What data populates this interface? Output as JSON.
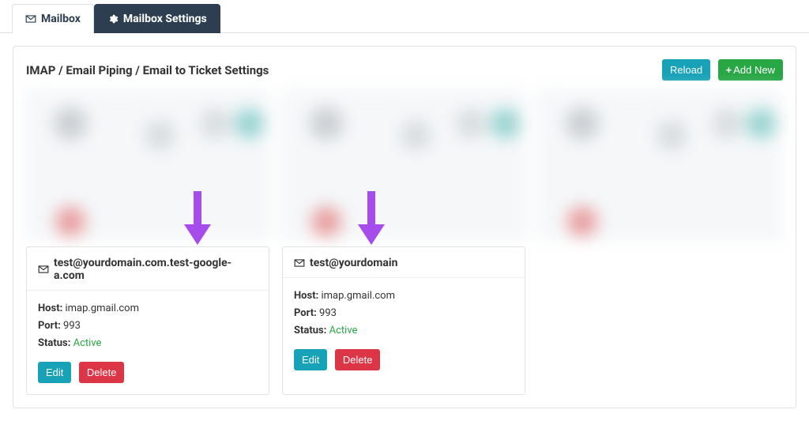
{
  "tabs": {
    "mailbox": "Mailbox",
    "settings": "Mailbox Settings"
  },
  "panel": {
    "title": "IMAP / Email Piping / Email to Ticket Settings",
    "reload": "Reload",
    "add_new": "Add New"
  },
  "labels": {
    "host": "Host:",
    "port": "Port:",
    "status": "Status:",
    "edit": "Edit",
    "delete": "Delete"
  },
  "cards": [
    {
      "email": "test@yourdomain.com.test-google-a.com",
      "host": "imap.gmail.com",
      "port": "993",
      "status": "Active"
    },
    {
      "email": "test@yourdomain",
      "host": "imap.gmail.com",
      "port": "993",
      "status": "Active"
    }
  ]
}
